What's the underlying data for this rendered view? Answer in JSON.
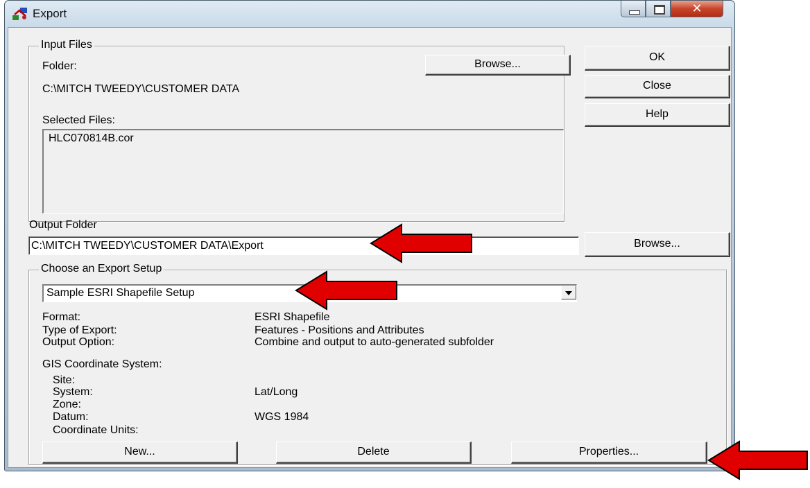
{
  "window": {
    "title": "Export"
  },
  "input_files": {
    "group_title": "Input Files",
    "folder_label": "Folder:",
    "browse_label": "Browse...",
    "folder_path": "C:\\MITCH TWEEDY\\CUSTOMER DATA",
    "selected_label": "Selected Files:",
    "files": [
      "HLC070814B.cor"
    ]
  },
  "side_buttons": {
    "ok": "OK",
    "close": "Close",
    "help": "Help"
  },
  "output": {
    "label": "Output Folder",
    "path": "C:\\MITCH TWEEDY\\CUSTOMER DATA\\Export",
    "browse_label": "Browse..."
  },
  "export_setup": {
    "group_title": "Choose an Export Setup",
    "selected": "Sample ESRI Shapefile Setup",
    "rows": [
      {
        "label": "Format:",
        "value": "ESRI Shapefile"
      },
      {
        "label": "Type of Export:",
        "value": "Features - Positions and Attributes"
      },
      {
        "label": "Output Option:",
        "value": "Combine and output to auto-generated subfolder"
      }
    ],
    "gis_title": "GIS Coordinate System:",
    "gis_rows": [
      {
        "label": "Site:",
        "value": ""
      },
      {
        "label": "System:",
        "value": "Lat/Long"
      },
      {
        "label": "Zone:",
        "value": ""
      },
      {
        "label": "Datum:",
        "value": "WGS 1984"
      },
      {
        "label": "Coordinate Units:",
        "value": ""
      }
    ],
    "new_label": "New...",
    "delete_label": "Delete",
    "properties_label": "Properties..."
  },
  "annotation_color": "#e00000"
}
